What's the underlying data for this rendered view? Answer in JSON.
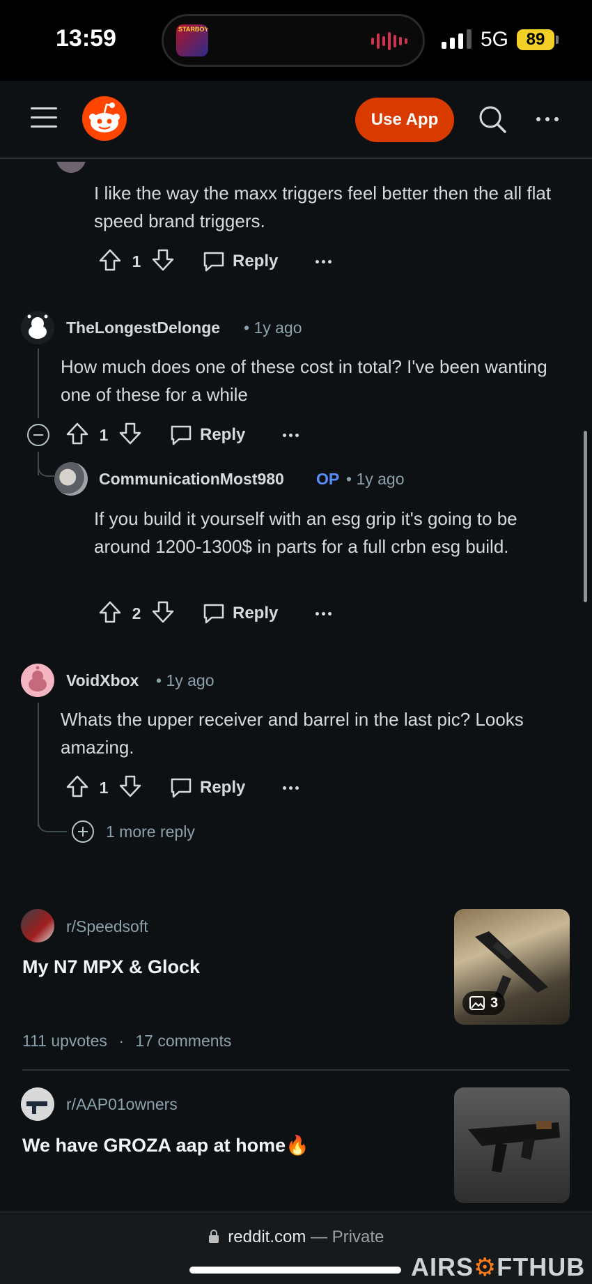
{
  "status": {
    "time": "13:59",
    "network": "5G",
    "battery": "89",
    "island_art_text": "STARBOY"
  },
  "nav": {
    "use_app_label": "Use App"
  },
  "comments": [
    {
      "text": "I like the way the maxx triggers feel better then the all flat speed brand triggers.",
      "votes": "1",
      "reply_label": "Reply"
    },
    {
      "username": "TheLongestDelonge",
      "time": "1y ago",
      "text": "How much does one of these cost in total? I've been wanting one of these for a while",
      "votes": "1",
      "reply_label": "Reply"
    },
    {
      "username": "CommunicationMost980",
      "op_badge": "OP",
      "time": "1y ago",
      "text": "If you build it yourself with an esg grip it's going to be around 1200-1300$ in parts for a full crbn esg build.",
      "votes": "2",
      "reply_label": "Reply"
    },
    {
      "username": "VoidXbox",
      "time": "1y ago",
      "text": "Whats the upper receiver and barrel in the last pic? Looks amazing.",
      "votes": "1",
      "reply_label": "Reply"
    }
  ],
  "more_replies": "1 more reply",
  "posts": [
    {
      "subreddit": "r/Speedsoft",
      "title": "My N7 MPX & Glock",
      "image_count": "3",
      "upvotes": "111 upvotes",
      "comments": "17 comments"
    },
    {
      "subreddit": "r/AAP01owners",
      "title": "We have GROZA aap at home🔥"
    }
  ],
  "browser": {
    "domain": "reddit.com",
    "mode": "Private",
    "separator": "—"
  },
  "watermark": {
    "part1": "AIRS",
    "part2": "FTHUB"
  },
  "colors": {
    "accent": "#ff4500",
    "use_app_bg": "#d93a00",
    "op": "#5a8dfc",
    "background": "#0e1113"
  }
}
